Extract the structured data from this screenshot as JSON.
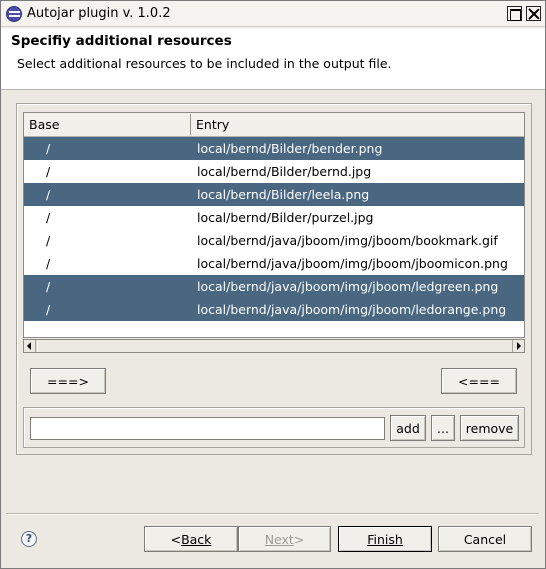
{
  "window": {
    "title": "Autojar plugin v. 1.0.2"
  },
  "header": {
    "title": "Specifiy additional resources",
    "description": "Select additional resources to be included in the output file."
  },
  "table": {
    "columns": [
      "Base",
      "Entry"
    ],
    "rows": [
      {
        "base": "/",
        "entry": "local/bernd/Bilder/bender.png",
        "selected": true
      },
      {
        "base": "/",
        "entry": "local/bernd/Bilder/bernd.jpg",
        "selected": false
      },
      {
        "base": "/",
        "entry": "local/bernd/Bilder/leela.png",
        "selected": true
      },
      {
        "base": "/",
        "entry": "local/bernd/Bilder/purzel.jpg",
        "selected": false
      },
      {
        "base": "/",
        "entry": "local/bernd/java/jboom/img/jboom/bookmark.gif",
        "selected": false
      },
      {
        "base": "/",
        "entry": "local/bernd/java/jboom/img/jboom/jboomicon.png",
        "selected": false
      },
      {
        "base": "/",
        "entry": "local/bernd/java/jboom/img/jboom/ledgreen.png",
        "selected": true
      },
      {
        "base": "/",
        "entry": "local/bernd/java/jboom/img/jboom/ledorange.png",
        "selected": true
      }
    ],
    "selection_color": "#4a6782"
  },
  "transfer": {
    "right_label": "===>",
    "left_label": "<==="
  },
  "path_row": {
    "input_value": "",
    "add_label": "add",
    "browse_label": "...",
    "remove_label": "remove"
  },
  "footer": {
    "help_icon": "help-icon",
    "back_arrow": "< ",
    "back_label": "Back",
    "next_label": "Next",
    "next_arrow": " >",
    "finish_label": "Finish",
    "cancel_label": "Cancel",
    "next_enabled": false
  }
}
